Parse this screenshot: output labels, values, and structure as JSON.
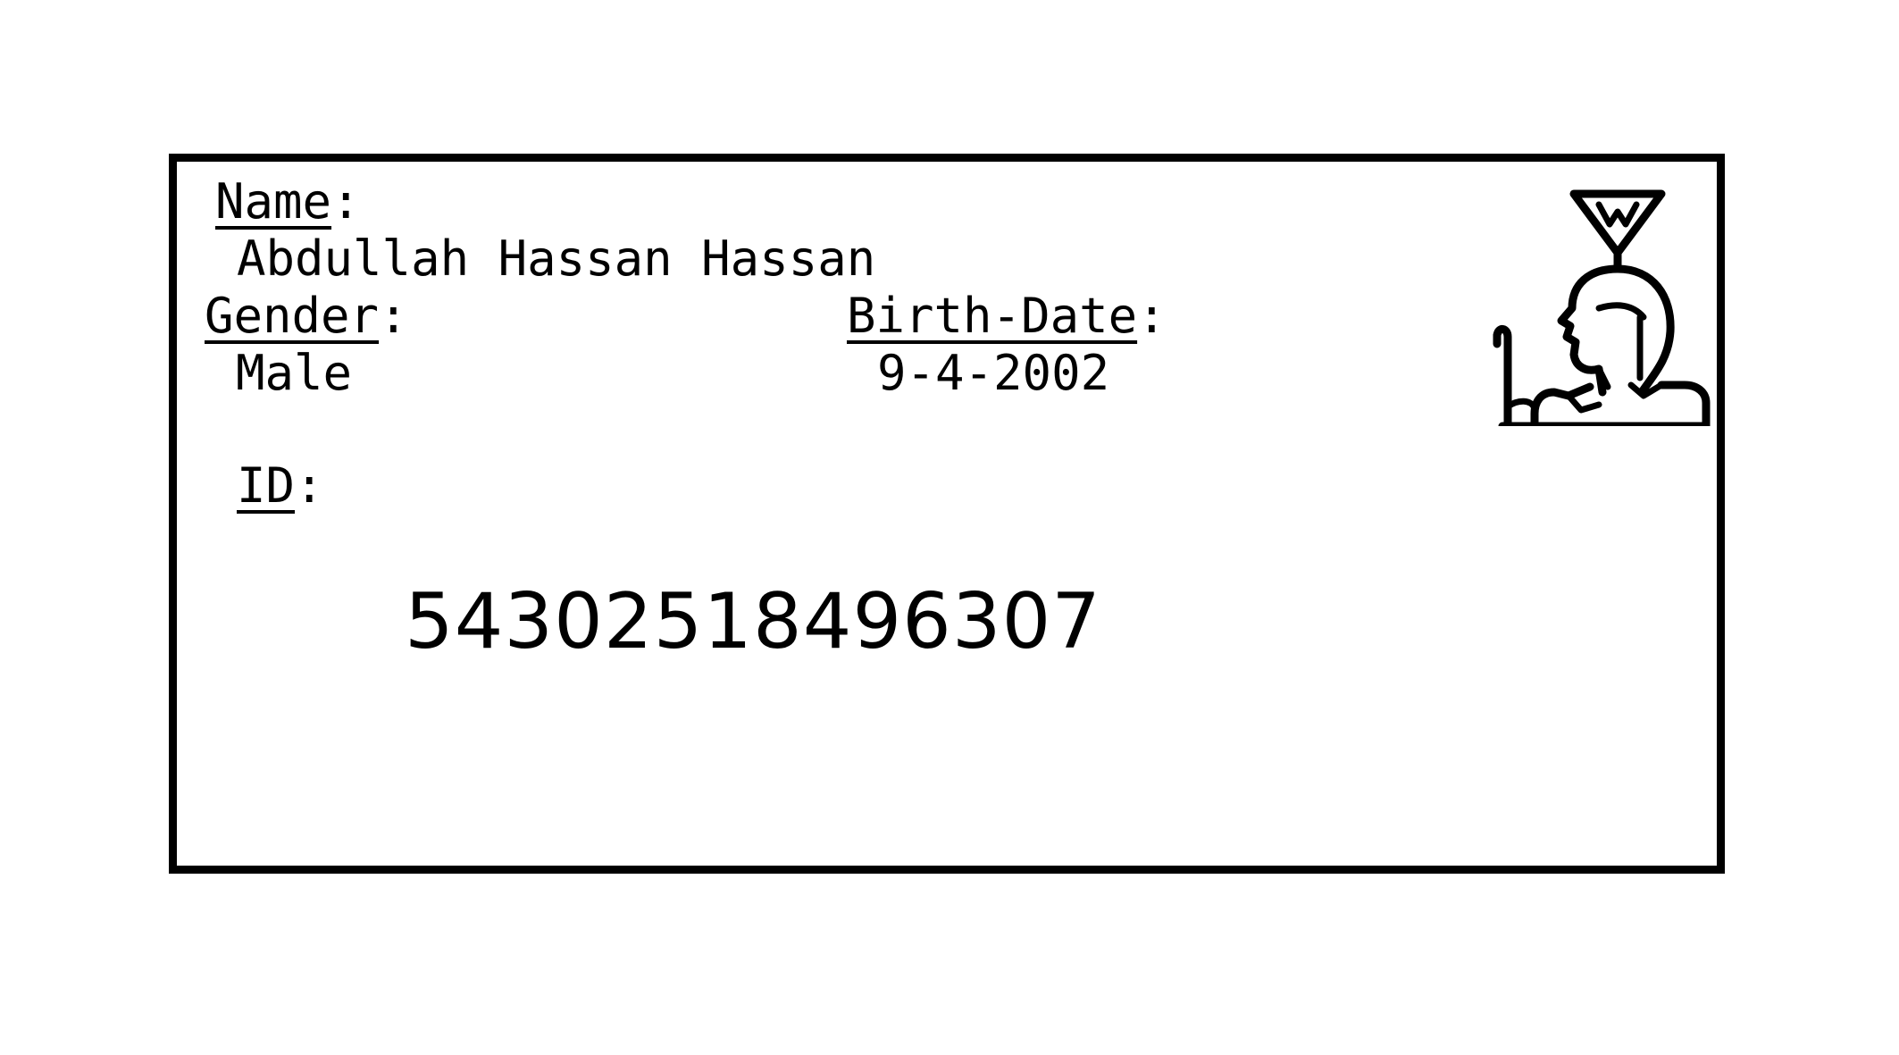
{
  "card": {
    "name_label": "Name",
    "name_value": "Abdullah Hassan Hassan",
    "gender_label": "Gender",
    "gender_value": "Male",
    "birthdate_label": "Birth-Date",
    "birthdate_value": "9-4-2002",
    "id_label": "ID",
    "id_value": "54302518496307",
    "label_suffix": ":"
  },
  "emblem": {
    "icon": "pharaoh-emblem-icon"
  }
}
